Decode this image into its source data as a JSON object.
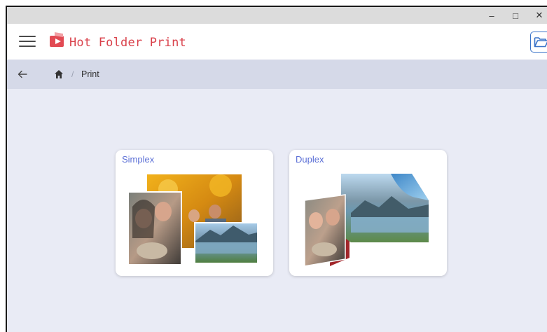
{
  "window": {
    "controls": {
      "minimize": "–",
      "maximize": "□",
      "close": "✕"
    }
  },
  "appbar": {
    "title": "Hot Folder Print",
    "menu_icon": "hamburger-menu-icon",
    "logo_icon": "printer-play-logo-icon",
    "folder_icon": "open-folder-icon"
  },
  "breadcrumb": {
    "back_icon": "arrow-left-icon",
    "home_icon": "home-icon",
    "separator": "/",
    "current": "Print"
  },
  "cards": [
    {
      "label": "Simplex",
      "illustration": "photo-stack-image"
    },
    {
      "label": "Duplex",
      "illustration": "folded-photo-image"
    }
  ],
  "colors": {
    "brand_red": "#d9414b",
    "accent_blue": "#5b6fd6",
    "background": "#e9ebf5",
    "breadcrumb_bg": "#d5d9e8"
  }
}
